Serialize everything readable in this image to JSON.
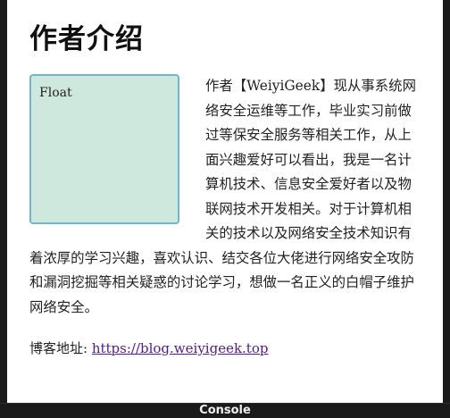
{
  "page": {
    "title": "作者介绍"
  },
  "float_box": {
    "label": "Float"
  },
  "intro": {
    "text": "作者【WeiyiGeek】现从事系统网络安全运维等工作，毕业实习前做过等保安全服务等相关工作，从上面兴趣爱好可以看出，我是一名计算机技术、信息安全爱好者以及物联网技术开发相关。对于计算机相关的技术以及网络安全技术知识有着浓厚的学习兴趣，喜欢认识、结交各位大佬进行网络安全攻防和漏洞挖掘等相关疑惑的讨论学习，想做一名正义的白帽子维护网络安全。"
  },
  "blog": {
    "label": "博客地址: ",
    "link_text": "https://blog.weiyigeek.top"
  },
  "console": {
    "label": "Console"
  }
}
